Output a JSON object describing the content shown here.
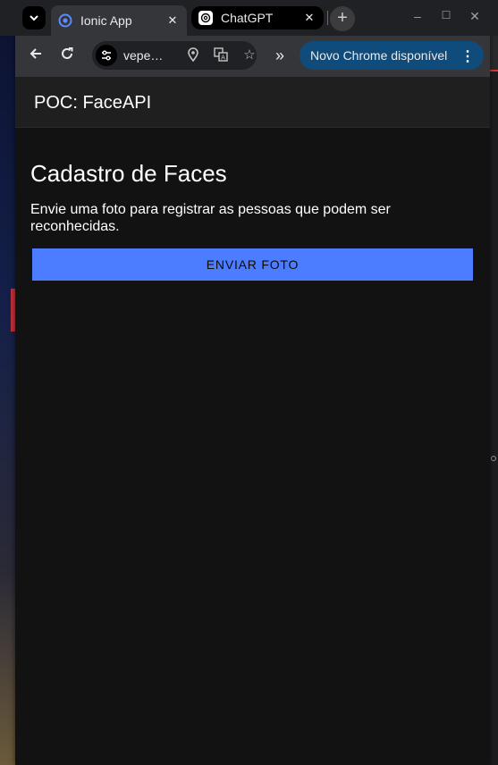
{
  "browser": {
    "tabs": [
      {
        "title": "Ionic App",
        "active": true,
        "icon": "ionic-icon"
      },
      {
        "title": "ChatGPT",
        "active": false,
        "icon": "chatgpt-icon"
      }
    ],
    "new_tab_symbol": "+",
    "window_controls": {
      "minimize": "–",
      "maximize": "☐",
      "close": "✕"
    },
    "toolbar": {
      "url": "vepe…",
      "update_label": "Novo Chrome disponível"
    }
  },
  "app": {
    "header_title": "POC: FaceAPI",
    "heading": "Cadastro de Faces",
    "description": "Envie uma foto para registrar as pessoas que podem ser reconhecidas.",
    "send_button": "ENVIAR FOTO"
  },
  "colors": {
    "button_bg": "#4c7cff",
    "content_bg": "#121212",
    "header_bg": "#1f1f1f",
    "update_pill_bg": "#0f4c7c"
  }
}
